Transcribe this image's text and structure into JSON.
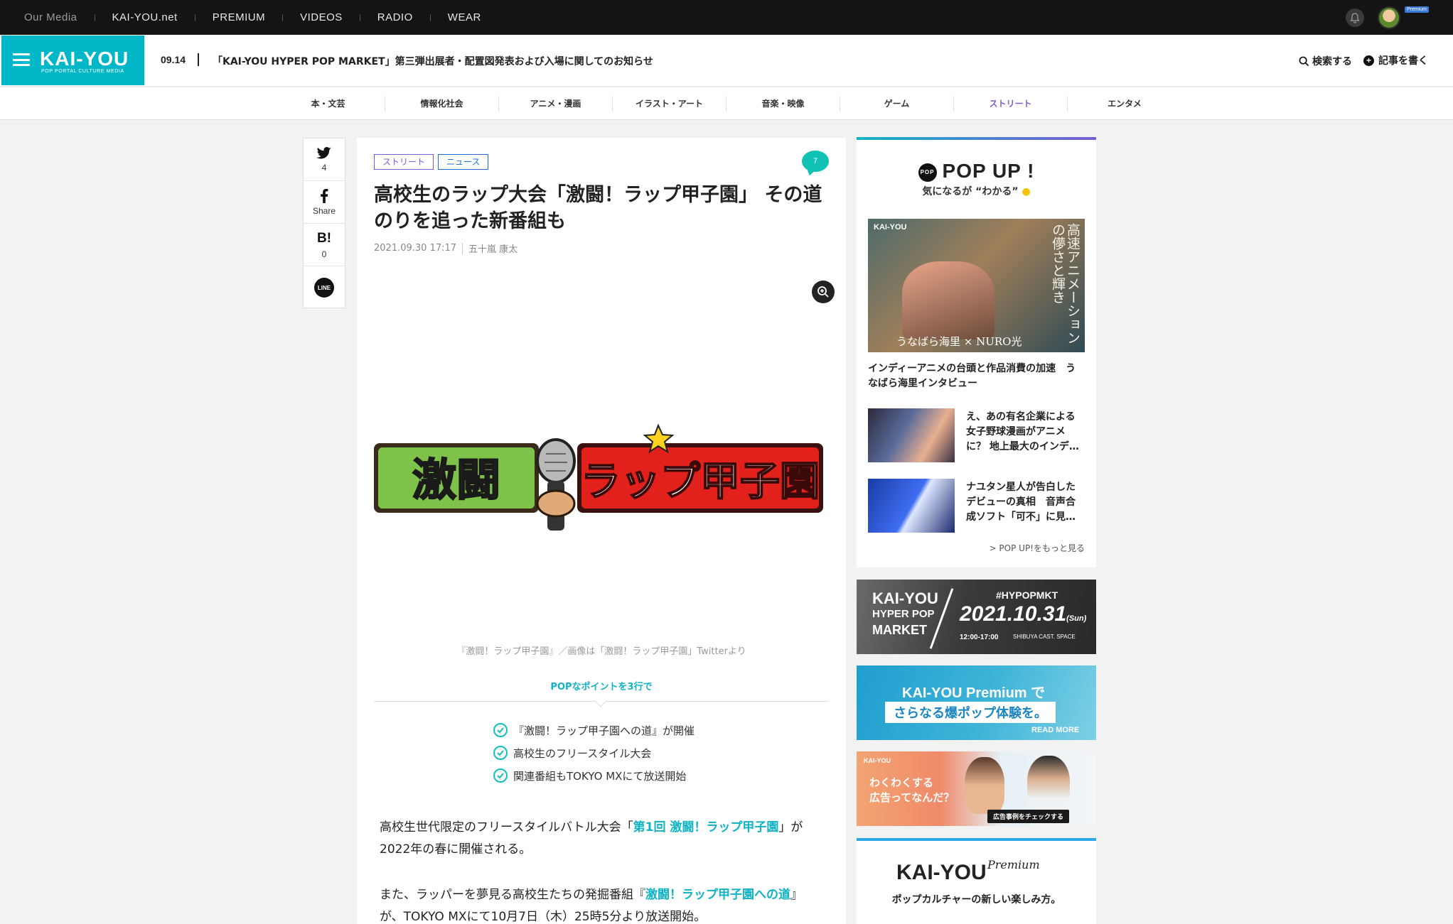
{
  "topbar": {
    "items": [
      "Our Media",
      "KAI-YOU.net",
      "PREMIUM",
      "VIDEOS",
      "RADIO",
      "WEAR"
    ],
    "premium_badge": "Premium"
  },
  "header": {
    "logo": "KAI-YOU",
    "logo_sub": "POP PORTAL CULTURE MEDIA",
    "news_date": "09.14",
    "news_text": "「KAI-YOU HYPER POP MARKET」第三弾出展者・配置図発表および入場に関してのお知らせ",
    "search_label": "検索する",
    "write_label": "記事を書く"
  },
  "categories": [
    {
      "label": "本・文芸"
    },
    {
      "label": "情報化社会"
    },
    {
      "label": "アニメ・漫画"
    },
    {
      "label": "イラスト・アート"
    },
    {
      "label": "音楽・映像"
    },
    {
      "label": "ゲーム"
    },
    {
      "label": "ストリート",
      "active": true
    },
    {
      "label": "エンタメ"
    }
  ],
  "share": {
    "twitter_count": "4",
    "facebook_label": "Share",
    "hatena_label": "B!",
    "hatena_count": "0",
    "line_label": "LINE"
  },
  "article": {
    "tags": [
      "ストリート",
      "ニュース"
    ],
    "comment_count": "7",
    "title": "高校生のラップ大会「激闘！ラップ甲子園」 その道のりを追った新番組も",
    "date": "2021.09.30 17:17",
    "author": "五十嵐 康太",
    "hero_logo_left": "激闘",
    "hero_logo_right": "ラップ甲子園",
    "caption": "『激闘！ラップ甲子園』／画像は「激闘！ラップ甲子園」Twitterより",
    "points_heading": "POPなポイントを3行で",
    "points": [
      "『激闘！ラップ甲子園への道』が開催",
      "高校生のフリースタイル大会",
      "関連番組もTOKYO MXにて放送開始"
    ],
    "p1_before": "高校生世代限定のフリースタイルバトル大会「",
    "p1_link": "第1回 激闘！ラップ甲子園",
    "p1_after": "」が2022年の春に開催される。",
    "p2_before": "また、ラッパーを夢見る高校生たちの発掘番組『",
    "p2_link": "激闘！ラップ甲子園への道",
    "p2_after": "』が、TOKYO MXにて10月7日（木）25時5分より放送開始。"
  },
  "sidebar": {
    "popup_icon": "POP",
    "popup_title": "POP UP !",
    "popup_sub": "気になるが “わかる”",
    "feature_title": "インディーアニメの台頭と作品消費の加速　うなばら海里インタビュー",
    "feature_brand": "KAI-YOU",
    "feature_vertical": "高速アニメーションの儚さと輝き",
    "feature_caption": "うなばら海里 × NURO光",
    "items": [
      {
        "title": "え、あの有名企業による女子野球漫画がアニメに？ 地上最大のインデ…"
      },
      {
        "title": "ナユタン星人が告白したデビューの真相　音声合成ソフト「可不」に見…"
      }
    ],
    "more": "> POP UP!をもっと見る",
    "banner1": {
      "title_top": "KAI-YOU",
      "title_mid": "HYPER POP",
      "title_bot": "MARKET",
      "hashtag": "#HYPOPMKT",
      "date": "2021.10.31",
      "dow": "(Sun)",
      "time": "12:00-17:00",
      "venue": "SHIBUYA CAST. SPACE"
    },
    "banner2": {
      "title": "KAI-YOU Premium で",
      "sub": "さらなる爆ポップ体験を。",
      "more": "READ MORE"
    },
    "banner3": {
      "brand": "KAI-YOU",
      "line1": "わくわくする",
      "line2": "広告ってなんだ？",
      "cta": "広告事例をチェックする"
    },
    "premium": {
      "logo": "KAI-YOU",
      "script": "Premium",
      "tagline": "ポップカルチャーの新しい楽しみ方。"
    }
  }
}
